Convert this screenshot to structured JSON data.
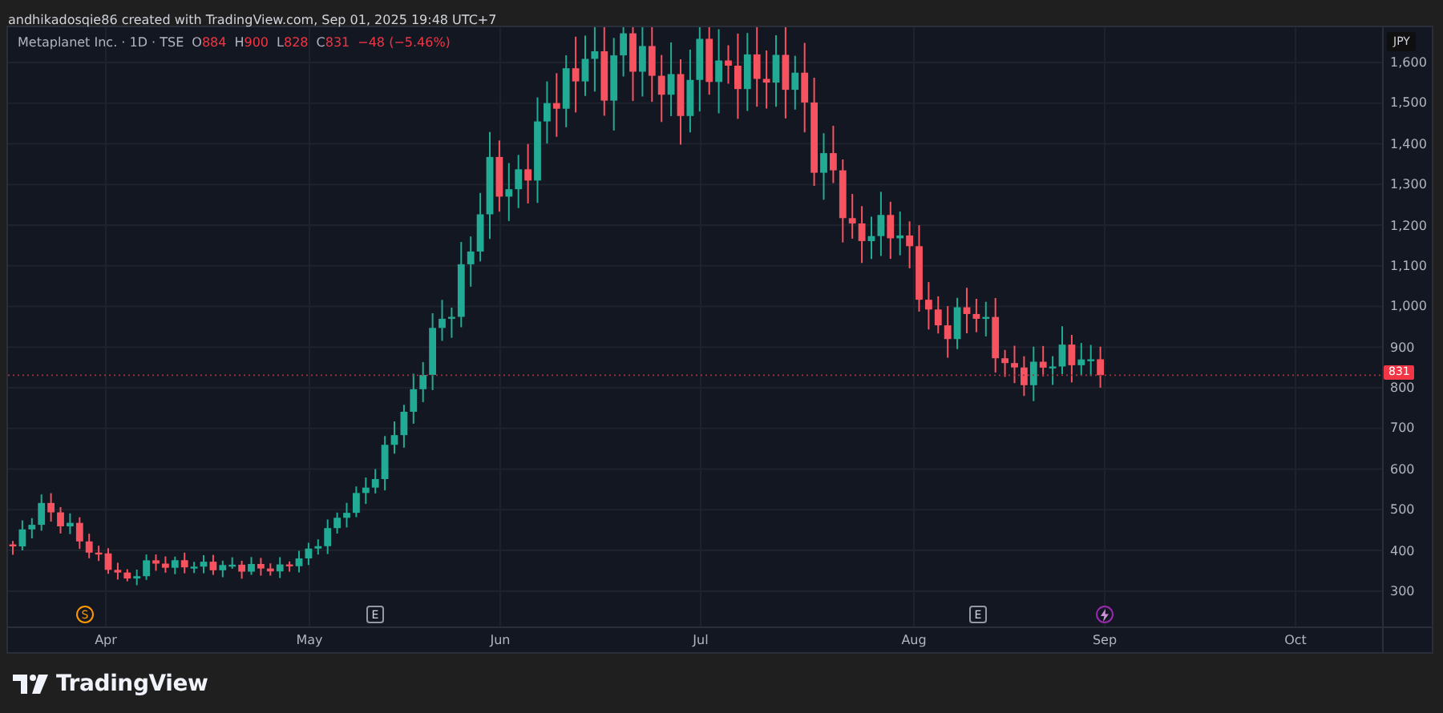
{
  "header": {
    "attribution": "andhikadosqie86 created with TradingView.com, Sep 01, 2025 19:48 UTC+7"
  },
  "legend": {
    "title": "Metaplanet Inc. · 1D · TSE",
    "ohlc": [
      {
        "label": "O",
        "value": "884"
      },
      {
        "label": "H",
        "value": "900"
      },
      {
        "label": "L",
        "value": "828"
      },
      {
        "label": "C",
        "value": "831"
      }
    ],
    "change": "−48 (−5.46%)"
  },
  "currency": "JPY",
  "last_price": "831",
  "price_axis": [
    "1,600",
    "1,500",
    "1,400",
    "1,300",
    "1,200",
    "1,100",
    "1,000",
    "900",
    "800",
    "700",
    "600",
    "500",
    "400",
    "300"
  ],
  "time_axis": [
    "Apr",
    "May",
    "Jun",
    "Jul",
    "Aug",
    "Sep",
    "Oct"
  ],
  "events": [
    {
      "kind": "split",
      "text": "S"
    },
    {
      "kind": "earnings",
      "text": "E"
    },
    {
      "kind": "earnings",
      "text": "E"
    },
    {
      "kind": "news"
    }
  ],
  "footer": {
    "logo_text": "TradingView"
  }
}
